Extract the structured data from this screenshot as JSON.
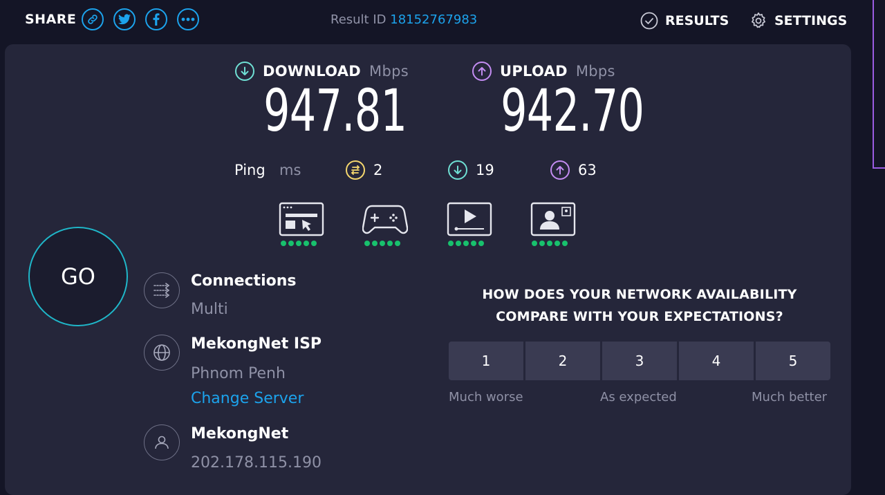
{
  "header": {
    "share_label": "SHARE",
    "share_buttons": [
      {
        "icon": "link-icon"
      },
      {
        "icon": "twitter-icon"
      },
      {
        "icon": "facebook-icon"
      },
      {
        "icon": "more-icon"
      }
    ],
    "result_id_label": "Result ID",
    "result_id_value": "18152767983",
    "results_label": "RESULTS",
    "settings_label": "SETTINGS"
  },
  "download": {
    "label": "DOWNLOAD",
    "unit": "Mbps",
    "value": "947.81"
  },
  "upload": {
    "label": "UPLOAD",
    "unit": "Mbps",
    "value": "942.70"
  },
  "ping": {
    "label": "Ping",
    "unit": "ms",
    "idle": "2",
    "download": "19",
    "upload": "63"
  },
  "use_cases": [
    {
      "icon": "web-browsing-icon",
      "rating": 5
    },
    {
      "icon": "gaming-icon",
      "rating": 5
    },
    {
      "icon": "video-streaming-icon",
      "rating": 5
    },
    {
      "icon": "video-chat-icon",
      "rating": 5
    }
  ],
  "go_label": "GO",
  "connections": {
    "title": "Connections",
    "value": "Multi"
  },
  "server": {
    "title": "MekongNet ISP",
    "location": "Phnom Penh",
    "change_label": "Change Server"
  },
  "provider": {
    "title": "MekongNet",
    "ip": "202.178.115.190"
  },
  "survey": {
    "question_line1": "HOW DOES YOUR NETWORK AVAILABILITY",
    "question_line2": "COMPARE WITH YOUR EXPECTATIONS?",
    "options": [
      "1",
      "2",
      "3",
      "4",
      "5"
    ],
    "low_label": "Much worse",
    "mid_label": "As expected",
    "high_label": "Much better"
  },
  "colors": {
    "accent_blue": "#1ca3ec",
    "download_teal": "#6fe0d4",
    "upload_purple": "#c38cf2",
    "ping_yellow": "#f5d76e",
    "rating_green": "#18c16d"
  }
}
